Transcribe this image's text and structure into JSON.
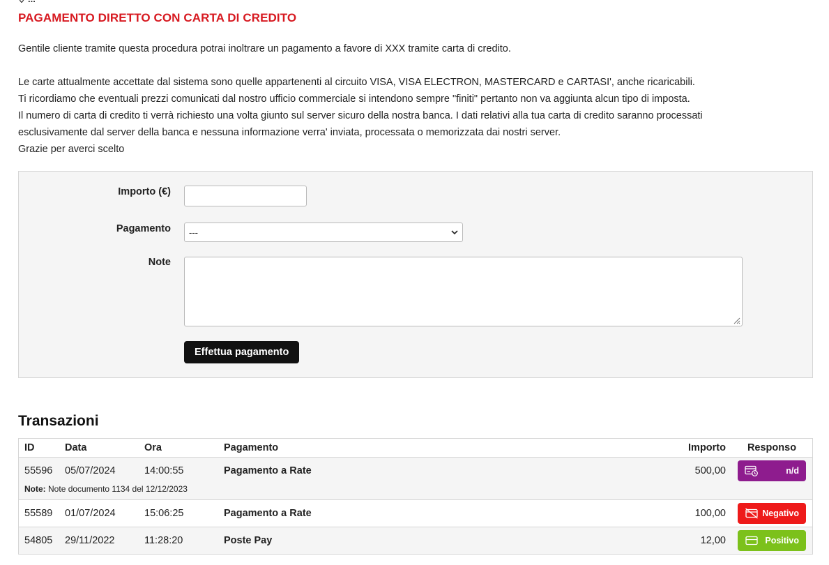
{
  "breadcrumb": {
    "text": "..."
  },
  "page_title": "PAGAMENTO DIRETTO CON CARTA DI CREDITO",
  "intro": {
    "line1": "Gentile cliente tramite questa procedura potrai inoltrare un pagamento a favore di XXX tramite carta di credito.",
    "line2": "Le carte attualmente accettate dal sistema sono quelle appartenenti al circuito VISA, VISA ELECTRON, MASTERCARD e CARTASI', anche ricaricabili.",
    "line3": "Ti ricordiamo che eventuali prezzi comunicati dal nostro ufficio commerciale si intendono sempre \"finiti\" pertanto non va aggiunta alcun tipo di imposta.",
    "line4": "Il numero di carta di credito ti verrà richiesto una volta giunto sul server sicuro della nostra banca. I dati relativi alla tua carta di credito saranno processati",
    "line5": "esclusivamente dal server della banca e nessuna informazione verra' inviata, processata o memorizzata dai nostri server.",
    "line6": "Grazie per averci scelto"
  },
  "form": {
    "amount_label": "Importo (€)",
    "amount_value": "",
    "payment_label": "Pagamento",
    "payment_selected": "---",
    "note_label": "Note",
    "note_value": "",
    "submit_label": "Effettua pagamento"
  },
  "transactions": {
    "title": "Transazioni",
    "headers": {
      "id": "ID",
      "date": "Data",
      "time": "Ora",
      "payment": "Pagamento",
      "amount": "Importo",
      "response": "Responso"
    },
    "note_prefix": "Note:",
    "rows": [
      {
        "id": "55596",
        "date": "05/07/2024",
        "time": "14:00:55",
        "payment": "Pagamento a Rate",
        "amount": "500,00",
        "response": "n/d",
        "note": "Note documento 1134 del 12/12/2023"
      },
      {
        "id": "55589",
        "date": "01/07/2024",
        "time": "15:06:25",
        "payment": "Pagamento a Rate",
        "amount": "100,00",
        "response": "Negativo"
      },
      {
        "id": "54805",
        "date": "29/11/2022",
        "time": "11:28:20",
        "payment": "Poste Pay",
        "amount": "12,00",
        "response": "Positivo"
      }
    ]
  },
  "colors": {
    "accent": "#d71920",
    "badge_nd": "#8e1c8e",
    "badge_negative": "#ee1a1a",
    "badge_positive": "#7cc11b"
  },
  "icons": {
    "breadcrumb": "map-pin-icon",
    "select": "chevron-down-icon",
    "nd": "card-pending-icon",
    "negative": "card-off-icon",
    "positive": "credit-card-icon"
  }
}
